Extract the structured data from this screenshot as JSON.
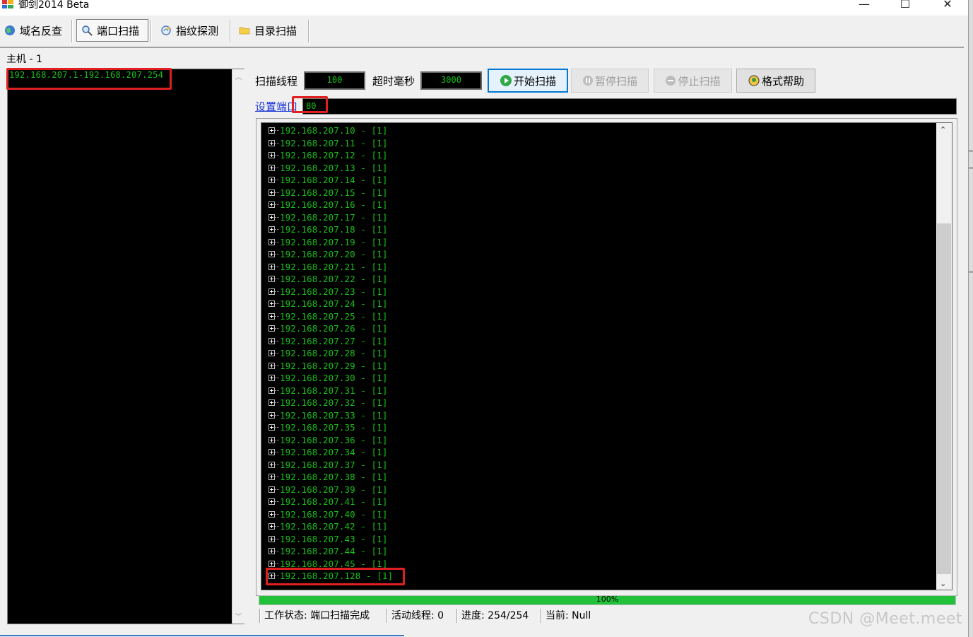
{
  "window": {
    "title": "御剑2014 Beta",
    "minimize": "—",
    "maximize": "☐",
    "close": "✕"
  },
  "toolbar": {
    "tabs": [
      {
        "label": "域名反查",
        "icon": "globe-icon",
        "active": false
      },
      {
        "label": "端口扫描",
        "icon": "magnifier-icon",
        "active": true
      },
      {
        "label": "指纹探测",
        "icon": "fingerprint-icon",
        "active": false
      },
      {
        "label": "目录扫描",
        "icon": "folder-icon",
        "active": false
      }
    ]
  },
  "host": {
    "label": "主机 - 1",
    "entries": [
      "192.168.207.1-192.168.207.254"
    ]
  },
  "controls": {
    "threads_label": "扫描线程",
    "threads_value": "100",
    "timeout_label": "超时毫秒",
    "timeout_value": "3000",
    "start_button": "开始扫描",
    "pause_button": "暂停扫描",
    "stop_button": "停止扫描",
    "help_button": "格式帮助",
    "set_port_link": "设置端口",
    "port_value": "80"
  },
  "results": {
    "rows": [
      "192.168.207.10 - [1]",
      "192.168.207.11 - [1]",
      "192.168.207.12 - [1]",
      "192.168.207.13 - [1]",
      "192.168.207.14 - [1]",
      "192.168.207.15 - [1]",
      "192.168.207.16 - [1]",
      "192.168.207.17 - [1]",
      "192.168.207.18 - [1]",
      "192.168.207.19 - [1]",
      "192.168.207.20 - [1]",
      "192.168.207.21 - [1]",
      "192.168.207.22 - [1]",
      "192.168.207.23 - [1]",
      "192.168.207.24 - [1]",
      "192.168.207.25 - [1]",
      "192.168.207.26 - [1]",
      "192.168.207.27 - [1]",
      "192.168.207.28 - [1]",
      "192.168.207.29 - [1]",
      "192.168.207.30 - [1]",
      "192.168.207.31 - [1]",
      "192.168.207.32 - [1]",
      "192.168.207.33 - [1]",
      "192.168.207.35 - [1]",
      "192.168.207.36 - [1]",
      "192.168.207.34 - [1]",
      "192.168.207.37 - [1]",
      "192.168.207.38 - [1]",
      "192.168.207.39 - [1]",
      "192.168.207.41 - [1]",
      "192.168.207.40 - [1]",
      "192.168.207.42 - [1]",
      "192.168.207.43 - [1]",
      "192.168.207.44 - [1]",
      "192.168.207.45 - [1]",
      "192.168.207.128 - [1]"
    ]
  },
  "progress": {
    "percent": 100,
    "label": "100%"
  },
  "status": {
    "work_state": "工作状态: 端口扫描完成",
    "active_threads": "活动线程: 0",
    "progress": "进度: 254/254",
    "current": "当前: Null"
  },
  "watermark": "CSDN @Meet.meet",
  "colors": {
    "terminal_bg": "#000000",
    "terminal_text": "#18c018",
    "highlight": "#e02020",
    "progress": "#21c13a",
    "link": "#1a36d6"
  }
}
